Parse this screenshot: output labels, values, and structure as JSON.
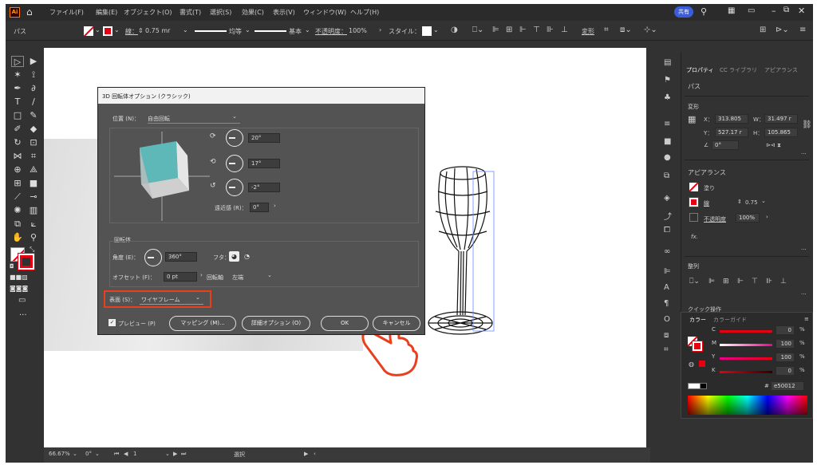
{
  "app": {
    "logo": "Ai",
    "home_icon": "home-icon"
  },
  "menu": [
    "ファイル(F)",
    "編集(E)",
    "オブジェクト(O)",
    "書式(T)",
    "選択(S)",
    "効果(C)",
    "表示(V)",
    "ウィンドウ(W)",
    "ヘルプ(H)"
  ],
  "topright": {
    "share": "共有"
  },
  "control": {
    "selection": "パス",
    "stroke_label": "線：",
    "stroke_value": "0.75 mr",
    "profile": "均等",
    "brush": "基本",
    "opacity_label": "不透明度：",
    "opacity_value": "100%",
    "style_label": "スタイル：",
    "transform": "変形"
  },
  "status": {
    "zoom": "66.67%",
    "rotation": "0°",
    "page": "1",
    "tool": "選択"
  },
  "dialog": {
    "title": "3D 回転体オプション (クラシック)",
    "position_label": "位置 (N)：",
    "position_value": "自由回転",
    "rot_x": "20°",
    "rot_y": "17°",
    "rot_z": "-2°",
    "perspective_label": "遠近感 (R)：",
    "perspective_value": "0°",
    "revolve_header": "回転体",
    "angle_label": "角度 (E)：",
    "angle_value": "360°",
    "cap_label": "フタ：",
    "offset_label": "オフセット (F)：",
    "offset_value": "0 pt",
    "axis_label": "回転軸",
    "axis_value": "左端",
    "surface_label": "表面 (S)：",
    "surface_value": "ワイヤフレーム",
    "preview_label": "プレビュー (P)",
    "mapping_button": "マッピング (M)...",
    "detail_button": "詳細オプション (O)",
    "ok_button": "OK",
    "cancel_button": "キャンセル"
  },
  "panel": {
    "tabs": [
      "プロパティ",
      "CC ライブラリ",
      "アピアランス"
    ],
    "selection": "パス",
    "transform_header": "変形",
    "x_label": "X：",
    "x_value": "313.805",
    "w_label": "W：",
    "w_value": "31.497 r",
    "y_label": "Y：",
    "y_value": "527.17 r",
    "h_label": "H：",
    "h_value": "105.865",
    "angle_value": "0°",
    "appearance_header": "アピアランス",
    "fill_label": "塗り",
    "stroke_label": "線",
    "stroke_value": "0.75",
    "opacity_label": "不透明度",
    "opacity_value": "100%",
    "fx_label": "fx.",
    "align_header": "整列",
    "quick_actions": "クイック操作"
  },
  "color": {
    "tabs": [
      "カラー",
      "カラーガイド"
    ],
    "channels": [
      {
        "name": "C",
        "value": "0"
      },
      {
        "name": "M",
        "value": "100"
      },
      {
        "name": "Y",
        "value": "100"
      },
      {
        "name": "K",
        "value": "0"
      }
    ],
    "pct": "%",
    "hex_prefix": "#",
    "hex": "e50012"
  },
  "accent": {
    "highlight": "#e8401f",
    "stroke_red": "#e50012",
    "cube": "#5fb8b8"
  }
}
